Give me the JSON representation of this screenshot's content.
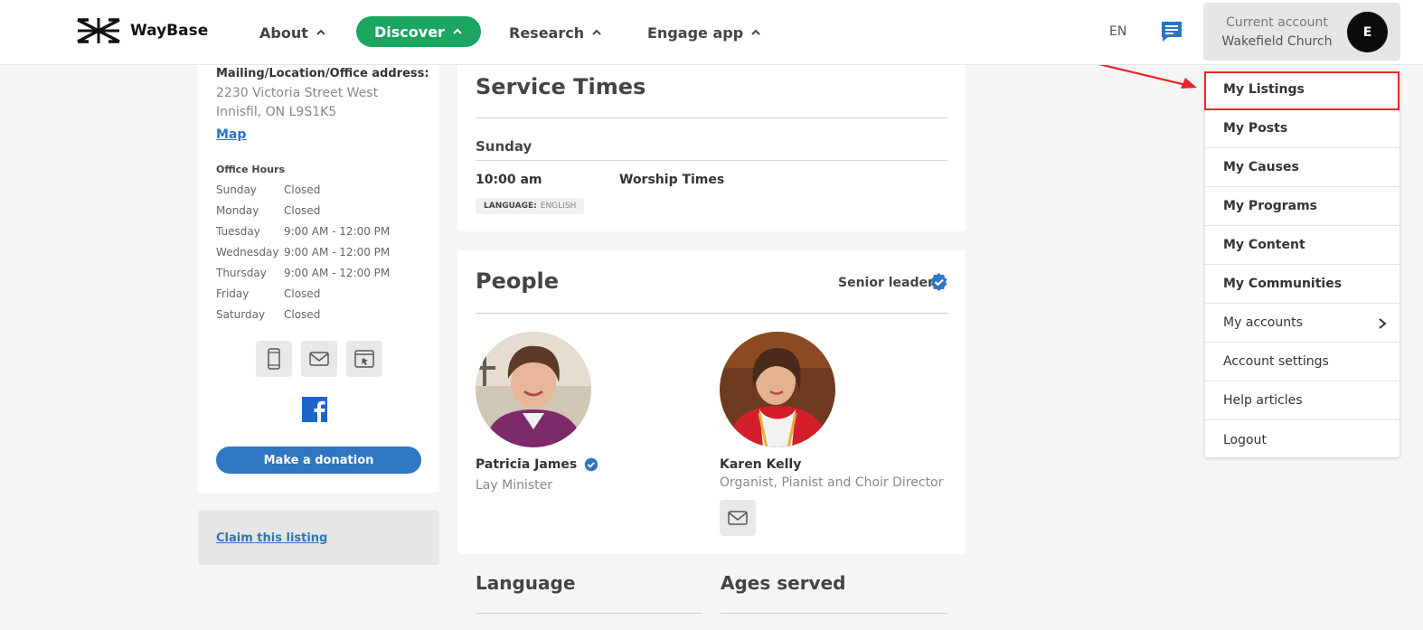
{
  "header": {
    "brand": "WayBase",
    "nav": [
      {
        "label": "About"
      },
      {
        "label": "Discover"
      },
      {
        "label": "Research"
      },
      {
        "label": "Engage app"
      }
    ],
    "language": "EN",
    "account_label": "Current account",
    "account_name": "Wakefield Church",
    "avatar_letter": "E"
  },
  "sidebar": {
    "address_title": "Mailing/Location/Office address:",
    "address_line1": "2230 Victoria Street West",
    "address_line2": "Innisfil, ON L9S1K5",
    "map_link": "Map",
    "office_hours_title": "Office Hours",
    "hours": [
      {
        "day": "Sunday",
        "time": "Closed"
      },
      {
        "day": "Monday",
        "time": "Closed"
      },
      {
        "day": "Tuesday",
        "time": "9:00 AM - 12:00 PM"
      },
      {
        "day": "Wednesday",
        "time": "9:00 AM - 12:00 PM"
      },
      {
        "day": "Thursday",
        "time": "9:00 AM - 12:00 PM"
      },
      {
        "day": "Friday",
        "time": "Closed"
      },
      {
        "day": "Saturday",
        "time": "Closed"
      }
    ],
    "donate_label": "Make a donation",
    "claim_label": "Claim this listing"
  },
  "service_times": {
    "title": "Service Times",
    "day": "Sunday",
    "time": "10:00 am",
    "name": "Worship Times",
    "language_key": "LANGUAGE:",
    "language_value": "ENGLISH"
  },
  "people": {
    "title": "People",
    "senior_label": "Senior leader",
    "members": [
      {
        "name": "Patricia James",
        "role": "Lay Minister"
      },
      {
        "name": "Karen Kelly",
        "role": "Organist, Pianist and Choir Director"
      }
    ]
  },
  "sections": {
    "language_title": "Language",
    "ages_title": "Ages served"
  },
  "dropdown": {
    "items": [
      {
        "label": "My Listings"
      },
      {
        "label": "My Posts"
      },
      {
        "label": "My Causes"
      },
      {
        "label": "My Programs"
      },
      {
        "label": "My Content"
      },
      {
        "label": "My Communities"
      },
      {
        "label": "My accounts"
      },
      {
        "label": "Account settings"
      },
      {
        "label": "Help articles"
      },
      {
        "label": "Logout"
      }
    ]
  },
  "colors": {
    "discover_green": "#1aa562",
    "link_blue": "#2b74c4",
    "highlight_red": "#e8252a"
  }
}
